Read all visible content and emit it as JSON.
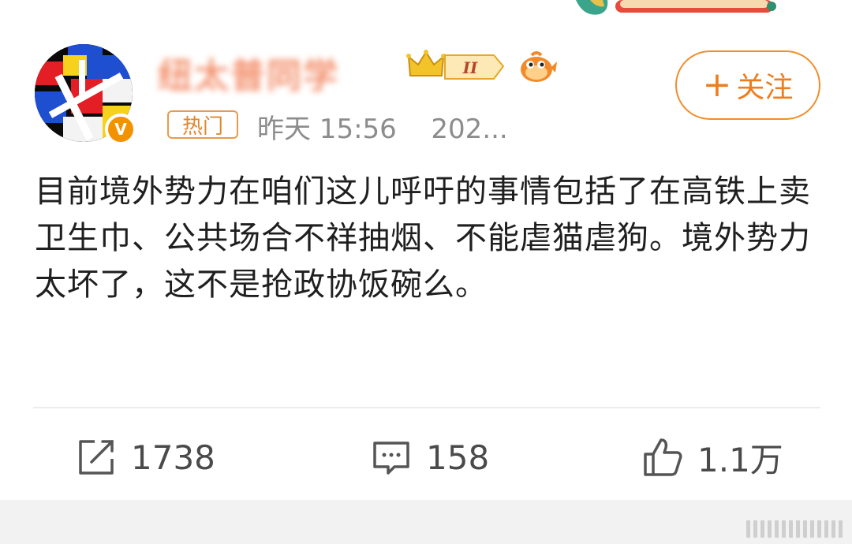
{
  "user": {
    "name": "纽太普同学",
    "level_badge": "II",
    "avatar_icon": "abstract-mondrian-avatar",
    "verified_mark": "V"
  },
  "follow_button": {
    "plus": "+",
    "label": "关注"
  },
  "post": {
    "hot_tag": "热门",
    "timestamp": "昨天 15:56",
    "source": "202...",
    "text": "目前境外势力在咱们这儿呼吁的事情包括了在高铁上卖卫生巾、公共场合不祥抽烟、不能虐猫虐狗。境外势力太坏了，这不是抢政协饭碗么。"
  },
  "actions": {
    "repost_count": "1738",
    "comment_count": "158",
    "like_count": "1.1万"
  },
  "colors": {
    "accent_orange": "#f08e2c",
    "meta_gray": "#8c8c8c",
    "text": "#1f1f1f"
  }
}
